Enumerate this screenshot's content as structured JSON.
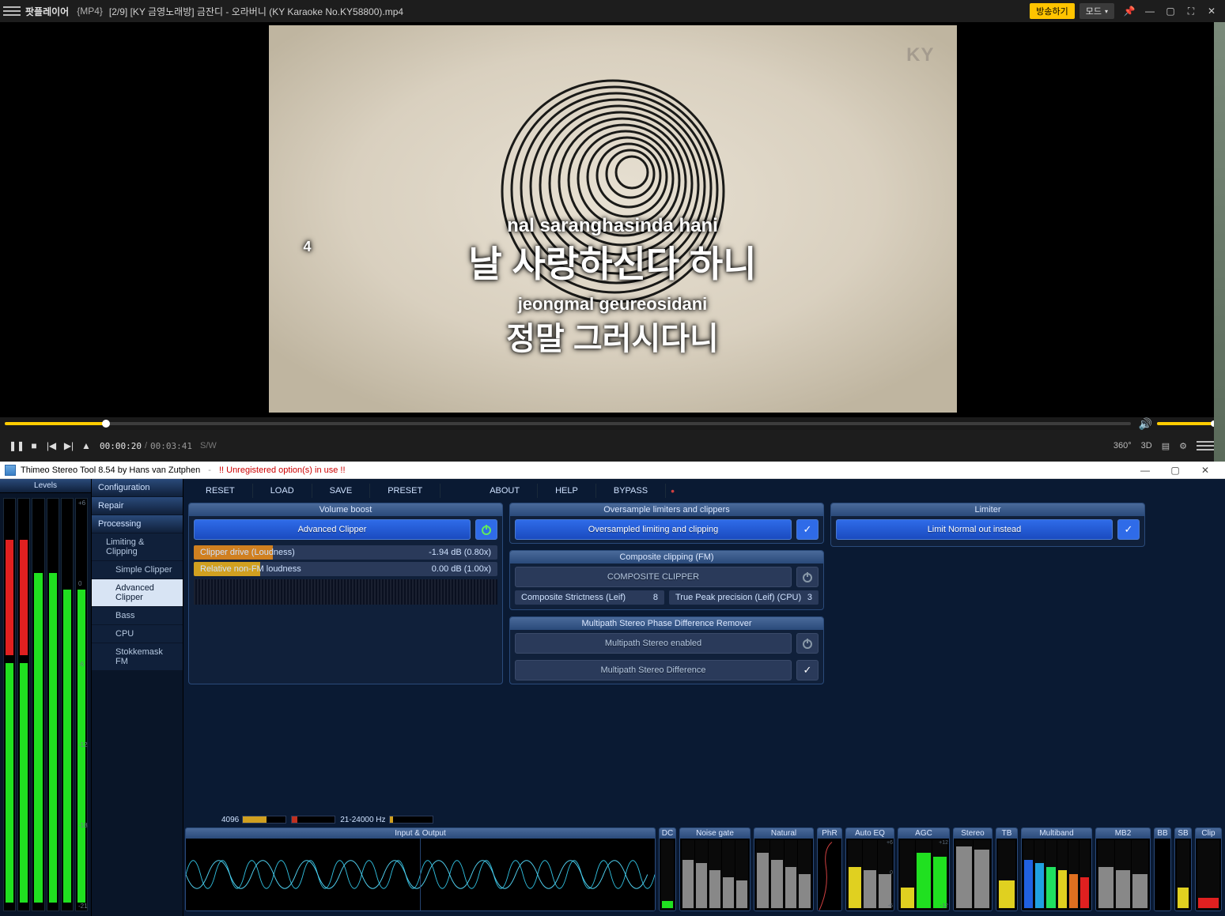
{
  "pot": {
    "app_name": "팟플레이어",
    "format": "{MP4}",
    "file_title": "[2/9] [KY 금영노래방] 금잔디 - 오라버니 (KY Karaoke No.KY58800).mp4",
    "broadcast": "방송하기",
    "mode": "모드",
    "video": {
      "logo": "KY",
      "count": "4",
      "rom1": "nal saranghasinda hani",
      "kor1": "날 사랑하신다 하니",
      "rom2": "jeongmal geureosidani",
      "kor2": "정말 그러시다니"
    },
    "time_cur": "00:00:20",
    "time_tot": "00:03:41",
    "sw": "S/W",
    "btn_360": "360°",
    "btn_3d": "3D"
  },
  "st": {
    "title": "Thimeo Stereo Tool 8.54 by Hans van Zutphen",
    "warn": "!! Unregistered option(s) in use !!",
    "levels_hdr": "Levels",
    "nav": {
      "config": "Configuration",
      "repair": "Repair",
      "processing": "Processing",
      "limiting": "Limiting & Clipping",
      "simple": "Simple Clipper",
      "advanced": "Advanced Clipper",
      "bass": "Bass",
      "cpu": "CPU",
      "stokke": "Stokkemask FM"
    },
    "menu": {
      "reset": "RESET",
      "load": "LOAD",
      "save": "SAVE",
      "preset": "PRESET",
      "about": "ABOUT",
      "help": "HELP",
      "bypass": "BYPASS"
    },
    "vol": {
      "hdr": "Volume boost",
      "btn": "Advanced Clipper",
      "s1_lbl": "Clipper drive (Loudness)",
      "s1_val": "-1.94 dB (0.80x)",
      "s2_lbl": "Relative non-FM loudness",
      "s2_val": "0.00 dB (1.00x)"
    },
    "over": {
      "hdr": "Oversample limiters and clippers",
      "btn": "Oversampled limiting and clipping"
    },
    "lim": {
      "hdr": "Limiter",
      "btn": "Limit Normal out instead"
    },
    "comp": {
      "hdr": "Composite clipping (FM)",
      "btn": "COMPOSITE CLIPPER",
      "h1_lbl": "Composite Strictness (Leif)",
      "h1_val": "8",
      "h2_lbl": "True Peak precision (Leif) (CPU)",
      "h2_val": "3"
    },
    "multi": {
      "hdr": "Multipath Stereo Phase Difference Remover",
      "b1": "Multipath Stereo enabled",
      "b2": "Multipath Stereo Difference"
    },
    "stats": {
      "s1": "4096",
      "s2": "",
      "s3": "21-24000 Hz",
      "s4": ""
    },
    "mods": {
      "io": "Input & Output",
      "dc": "DC",
      "noise": "Noise gate",
      "natural": "Natural",
      "phr": "PhR",
      "autoeq": "Auto EQ",
      "agc": "AGC",
      "stereo": "Stereo",
      "tb": "TB",
      "multiband": "Multiband",
      "mb2": "MB2",
      "bb": "BB",
      "sb": "SB",
      "clip": "Clip"
    }
  }
}
